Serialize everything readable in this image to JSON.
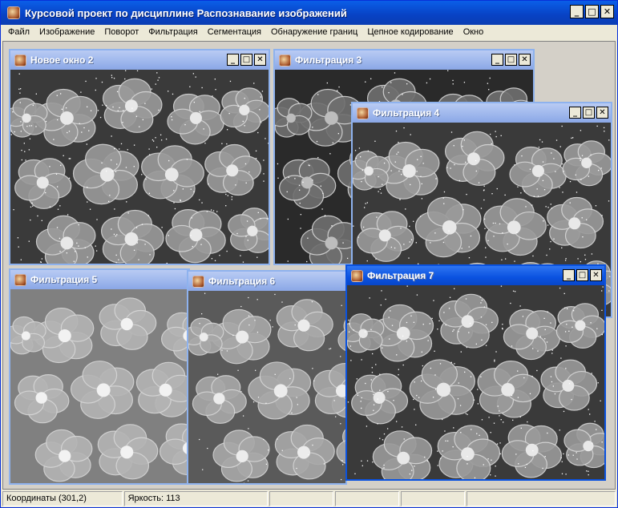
{
  "app": {
    "title": "Курсовой проект по дисциплине Распознавание изображений",
    "buttons": {
      "minimize": "_",
      "maximize": "□",
      "close": "✕"
    }
  },
  "menu": [
    "Файл",
    "Изображение",
    "Поворот",
    "Фильтрация",
    "Сегментация",
    "Обнаружение границ",
    "Цепное кодирование",
    "Окно"
  ],
  "windows": [
    {
      "title": "Новое окно 2",
      "active": false,
      "icon": "flower-app-icon",
      "style": "noisy"
    },
    {
      "title": "Фильтрация 3",
      "active": false,
      "icon": "flower-app-icon",
      "style": "dark"
    },
    {
      "title": "Фильтрация 4",
      "active": false,
      "icon": "flower-app-icon",
      "style": "noisy"
    },
    {
      "title": "Фильтрация 5",
      "active": false,
      "icon": "flower-app-icon",
      "style": "smooth"
    },
    {
      "title": "Фильтрация 6",
      "active": false,
      "icon": "flower-app-icon",
      "style": "grainy"
    },
    {
      "title": "Фильтрация 7",
      "active": true,
      "icon": "flower-app-icon",
      "style": "noisy"
    }
  ],
  "status": {
    "coords": "Координаты (301,2)",
    "brightness": "Яркость: 113",
    "panel3": "",
    "panel4": "",
    "panel5": "",
    "panel6": ""
  },
  "colors": {
    "active_title": "#0a52e0",
    "inactive_title": "#9db6ec",
    "window_face": "#ece9d8"
  }
}
